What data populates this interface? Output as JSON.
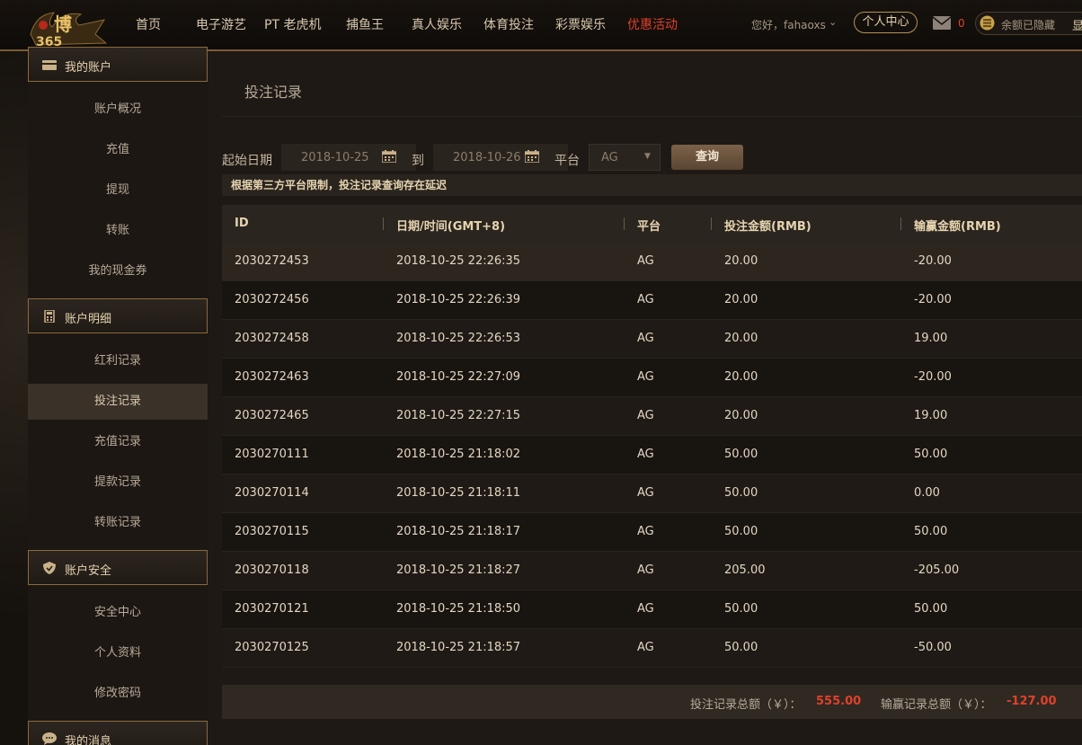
{
  "header": {
    "nav": [
      "首页",
      "电子游艺",
      "PT 老虎机",
      "捕鱼王",
      "真人娱乐",
      "体育投注",
      "彩票娱乐",
      "优惠活动"
    ],
    "greeting": "您好，fahaoxs",
    "personal_center": "个人中心",
    "mail_count": "0",
    "balance_hidden": "余额已隐藏",
    "balance_show": "显",
    "colors": {
      "accent": "#b59155",
      "hot": "#e0402c"
    }
  },
  "sidebar": {
    "sections": [
      {
        "title": "我的账户",
        "icon": "card-icon",
        "items": [
          "账户概况",
          "充值",
          "提现",
          "转账",
          "我的现金券"
        ]
      },
      {
        "title": "账户明细",
        "icon": "calculator-icon",
        "items": [
          "红利记录",
          "投注记录",
          "充值记录",
          "提款记录",
          "转账记录"
        ]
      },
      {
        "title": "账户安全",
        "icon": "shield-icon",
        "items": [
          "安全中心",
          "个人资料",
          "修改密码"
        ]
      },
      {
        "title": "我的消息",
        "icon": "chat-icon",
        "items": []
      }
    ],
    "active_item": "投注记录"
  },
  "main": {
    "title": "投注记录",
    "filter": {
      "start_label": "起始日期",
      "start_date": "2018-10-25",
      "to_label": "到",
      "end_date": "2018-10-26",
      "platform_label": "平台",
      "platform_value": "AG",
      "query_button": "查询"
    },
    "notice": "根据第三方平台限制，投注记录查询存在延迟",
    "table": {
      "columns": [
        "ID",
        "日期/时间(GMT+8)",
        "平台",
        "投注金额(RMB)",
        "输赢金额(RMB)"
      ],
      "rows": [
        [
          "2030272453",
          "2018-10-25 22:26:35",
          "AG",
          "20.00",
          "-20.00"
        ],
        [
          "2030272456",
          "2018-10-25 22:26:39",
          "AG",
          "20.00",
          "-20.00"
        ],
        [
          "2030272458",
          "2018-10-25 22:26:53",
          "AG",
          "20.00",
          "19.00"
        ],
        [
          "2030272463",
          "2018-10-25 22:27:09",
          "AG",
          "20.00",
          "-20.00"
        ],
        [
          "2030272465",
          "2018-10-25 22:27:15",
          "AG",
          "20.00",
          "19.00"
        ],
        [
          "2030270111",
          "2018-10-25 21:18:02",
          "AG",
          "50.00",
          "50.00"
        ],
        [
          "2030270114",
          "2018-10-25 21:18:11",
          "AG",
          "50.00",
          "0.00"
        ],
        [
          "2030270115",
          "2018-10-25 21:18:17",
          "AG",
          "50.00",
          "50.00"
        ],
        [
          "2030270118",
          "2018-10-25 21:18:27",
          "AG",
          "205.00",
          "-205.00"
        ],
        [
          "2030270121",
          "2018-10-25 21:18:50",
          "AG",
          "50.00",
          "50.00"
        ],
        [
          "2030270125",
          "2018-10-25 21:18:57",
          "AG",
          "50.00",
          "-50.00"
        ]
      ]
    },
    "summary": {
      "bet_total_label": "投注记录总额（￥）：",
      "bet_total": "555.00",
      "winloss_total_label": "输赢记录总额（￥）：",
      "winloss_total": "-127.00"
    }
  }
}
